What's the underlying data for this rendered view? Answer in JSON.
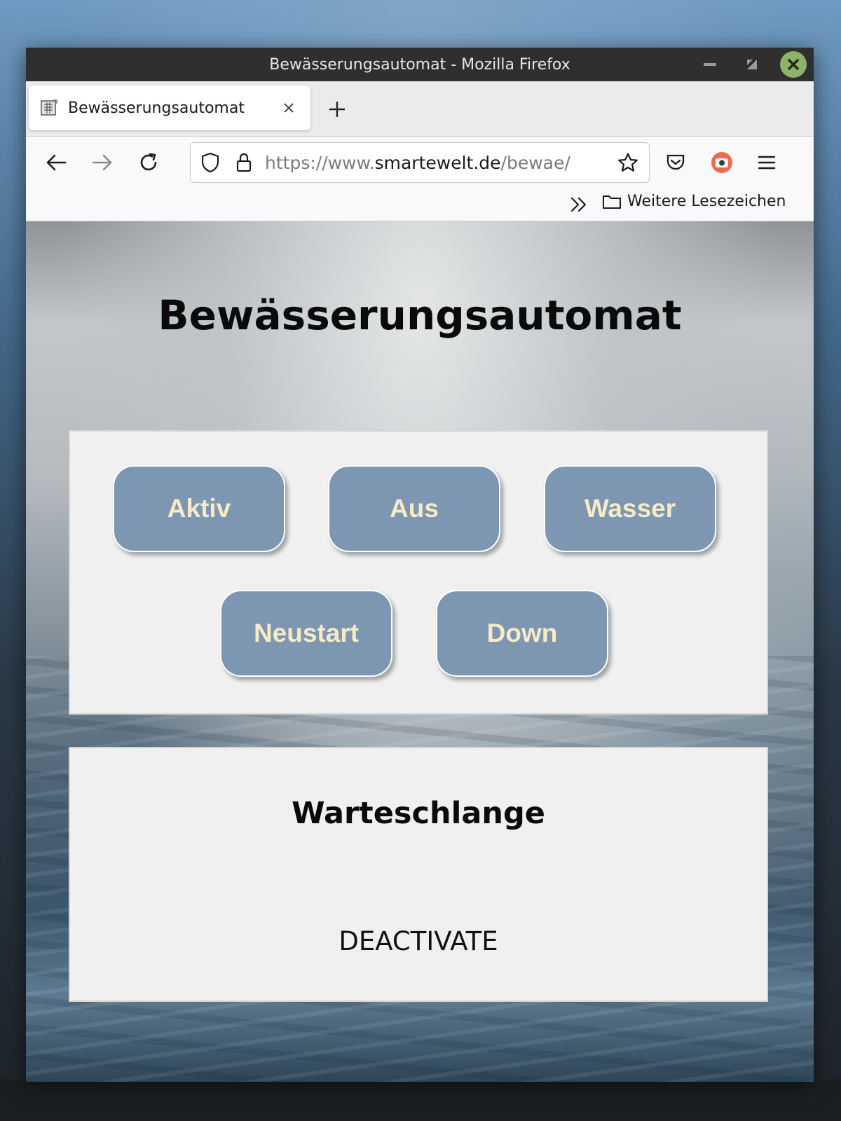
{
  "window": {
    "title": "Bewässerungsautomat - Mozilla Firefox"
  },
  "tabs": [
    {
      "label": "Bewässerungsautomat",
      "active": true
    }
  ],
  "urlbar": {
    "prefix": "https://www.",
    "domain": "smartewelt.de",
    "path": "/bewae/"
  },
  "bookmarks": {
    "folder_label": "Weitere Lesezeichen"
  },
  "page": {
    "title": "Bewässerungsautomat",
    "buttons": [
      "Aktiv",
      "Aus",
      "Wasser",
      "Neustart",
      "Down"
    ],
    "queue": {
      "title": "Warteschlange",
      "items": [
        "DEACTIVATE"
      ]
    }
  },
  "colors": {
    "button_bg": "#7d97b3",
    "button_text": "#f7ebc5",
    "panel_bg": "#f0f0f0",
    "titlebar_bg": "#2f2f2f",
    "close_button": "#8db36a"
  },
  "icons": {
    "back": "arrow-left-icon",
    "forward": "arrow-right-icon",
    "reload": "reload-icon",
    "shield": "shield-icon",
    "lock": "lock-icon",
    "bookmark_star": "star-icon",
    "pocket": "pocket-icon",
    "extension": "screenshot-extension-icon",
    "menu": "hamburger-menu-icon",
    "bookmarks_overflow": "double-chevron-icon",
    "folder": "folder-icon"
  }
}
